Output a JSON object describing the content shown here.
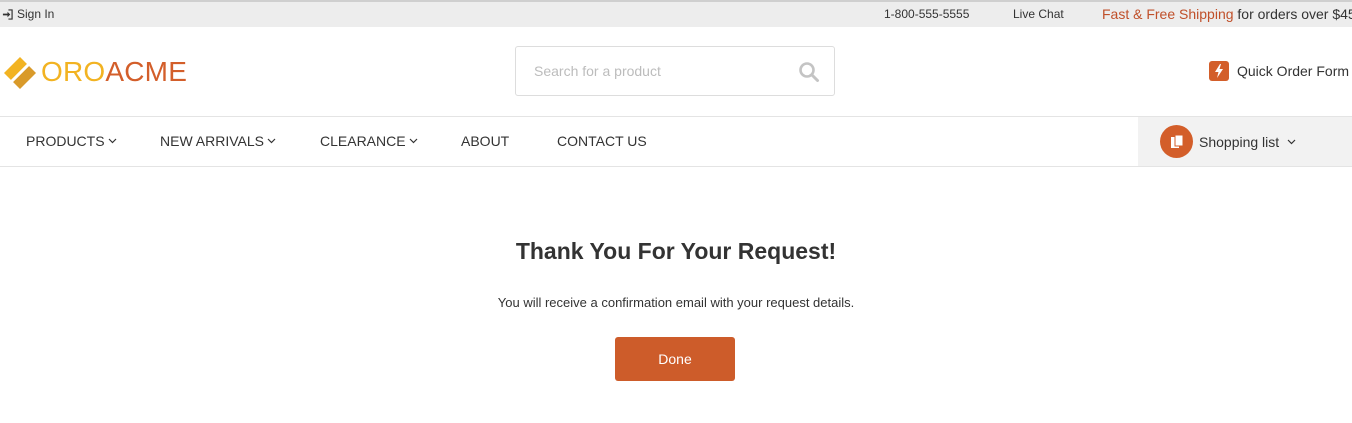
{
  "topbar": {
    "signin": "Sign In",
    "phone": "1-800-555-5555",
    "live_chat": "Live Chat",
    "shipping_highlight": "Fast & Free Shipping",
    "shipping_rest": "for orders over $45"
  },
  "header": {
    "logo_part1": "ORO",
    "logo_part2": "ACME",
    "search_placeholder": "Search for a product",
    "quick_order": "Quick Order Form"
  },
  "nav": {
    "items": [
      "PRODUCTS",
      "NEW ARRIVALS",
      "CLEARANCE",
      "ABOUT",
      "CONTACT US"
    ],
    "shopping_list": "Shopping list"
  },
  "main": {
    "title": "Thank You For Your Request!",
    "message": "You will receive a confirmation email with your request details.",
    "done": "Done"
  },
  "colors": {
    "accent": "#d35e2a",
    "logo_yellow": "#f2b322",
    "topbar_bg": "#ededed"
  },
  "icons": [
    "sign-in-icon",
    "logo-mark-icon",
    "search-icon",
    "lightning-icon",
    "chevron-down-icon",
    "shopping-list-icon"
  ]
}
